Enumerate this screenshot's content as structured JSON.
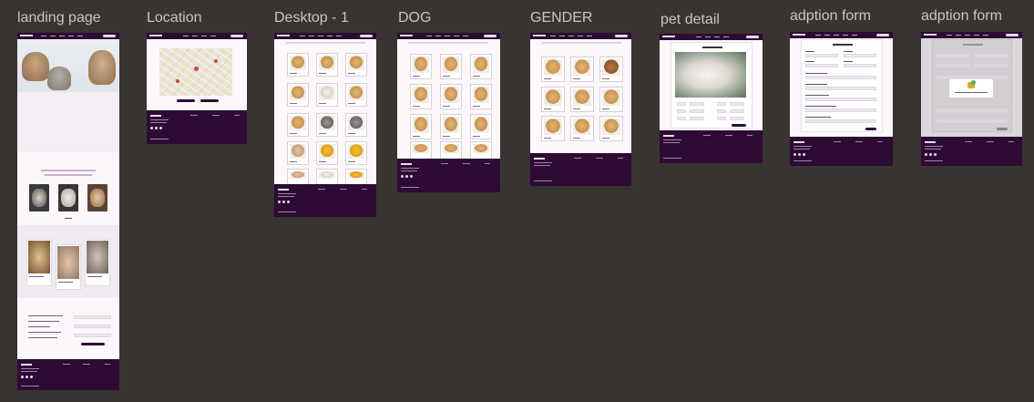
{
  "frames": [
    {
      "id": "landing",
      "label": "landing page"
    },
    {
      "id": "location",
      "label": "Location"
    },
    {
      "id": "desktop1",
      "label": "Desktop - 1"
    },
    {
      "id": "dog",
      "label": "DOG"
    },
    {
      "id": "gender",
      "label": "GENDER"
    },
    {
      "id": "petdetail",
      "label": "pet detail"
    },
    {
      "id": "adoption1",
      "label": "adption form"
    },
    {
      "id": "adoption2",
      "label": "adption form"
    }
  ],
  "colors": {
    "canvas": "#383432",
    "frame_bg": "#fbf7fb",
    "brand_dark": "#2d0b34",
    "label": "#c9c6c3"
  },
  "icons": {
    "map": "map-icon",
    "pet_photo": "pet-photo-icon",
    "success_badge": "success-badge-icon"
  }
}
